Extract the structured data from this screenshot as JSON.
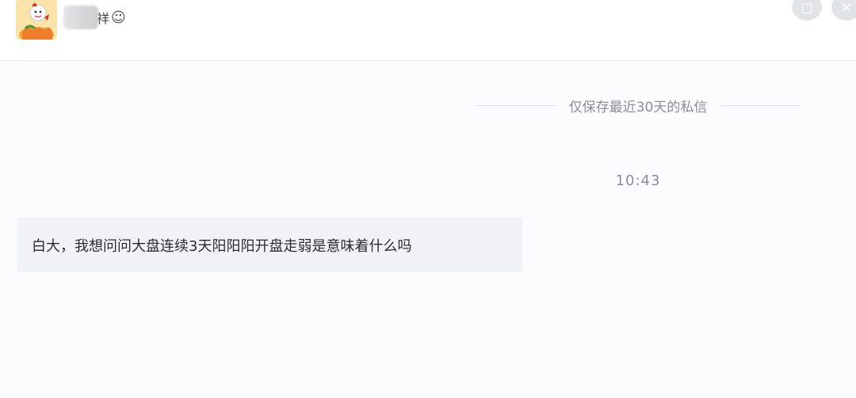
{
  "contact": {
    "name_visible": "祥",
    "name_suffix_icon": "smile-face-icon",
    "avatar_icon": "cartoon-avatar-icon"
  },
  "header": {
    "setting_icon": "settings-icon",
    "close_icon": "close-icon"
  },
  "notice": {
    "text": "仅保存最近30天的私信"
  },
  "conversation": {
    "timestamp": "10:43",
    "messages": [
      {
        "text": "白大，我想问问大盘连续3天阳阳阳开盘走弱是意味着什么吗"
      }
    ]
  },
  "colors": {
    "bubble_bg": "#f1f2f6",
    "notice_text": "#8a8d94",
    "divider": "#e6e9ef"
  }
}
